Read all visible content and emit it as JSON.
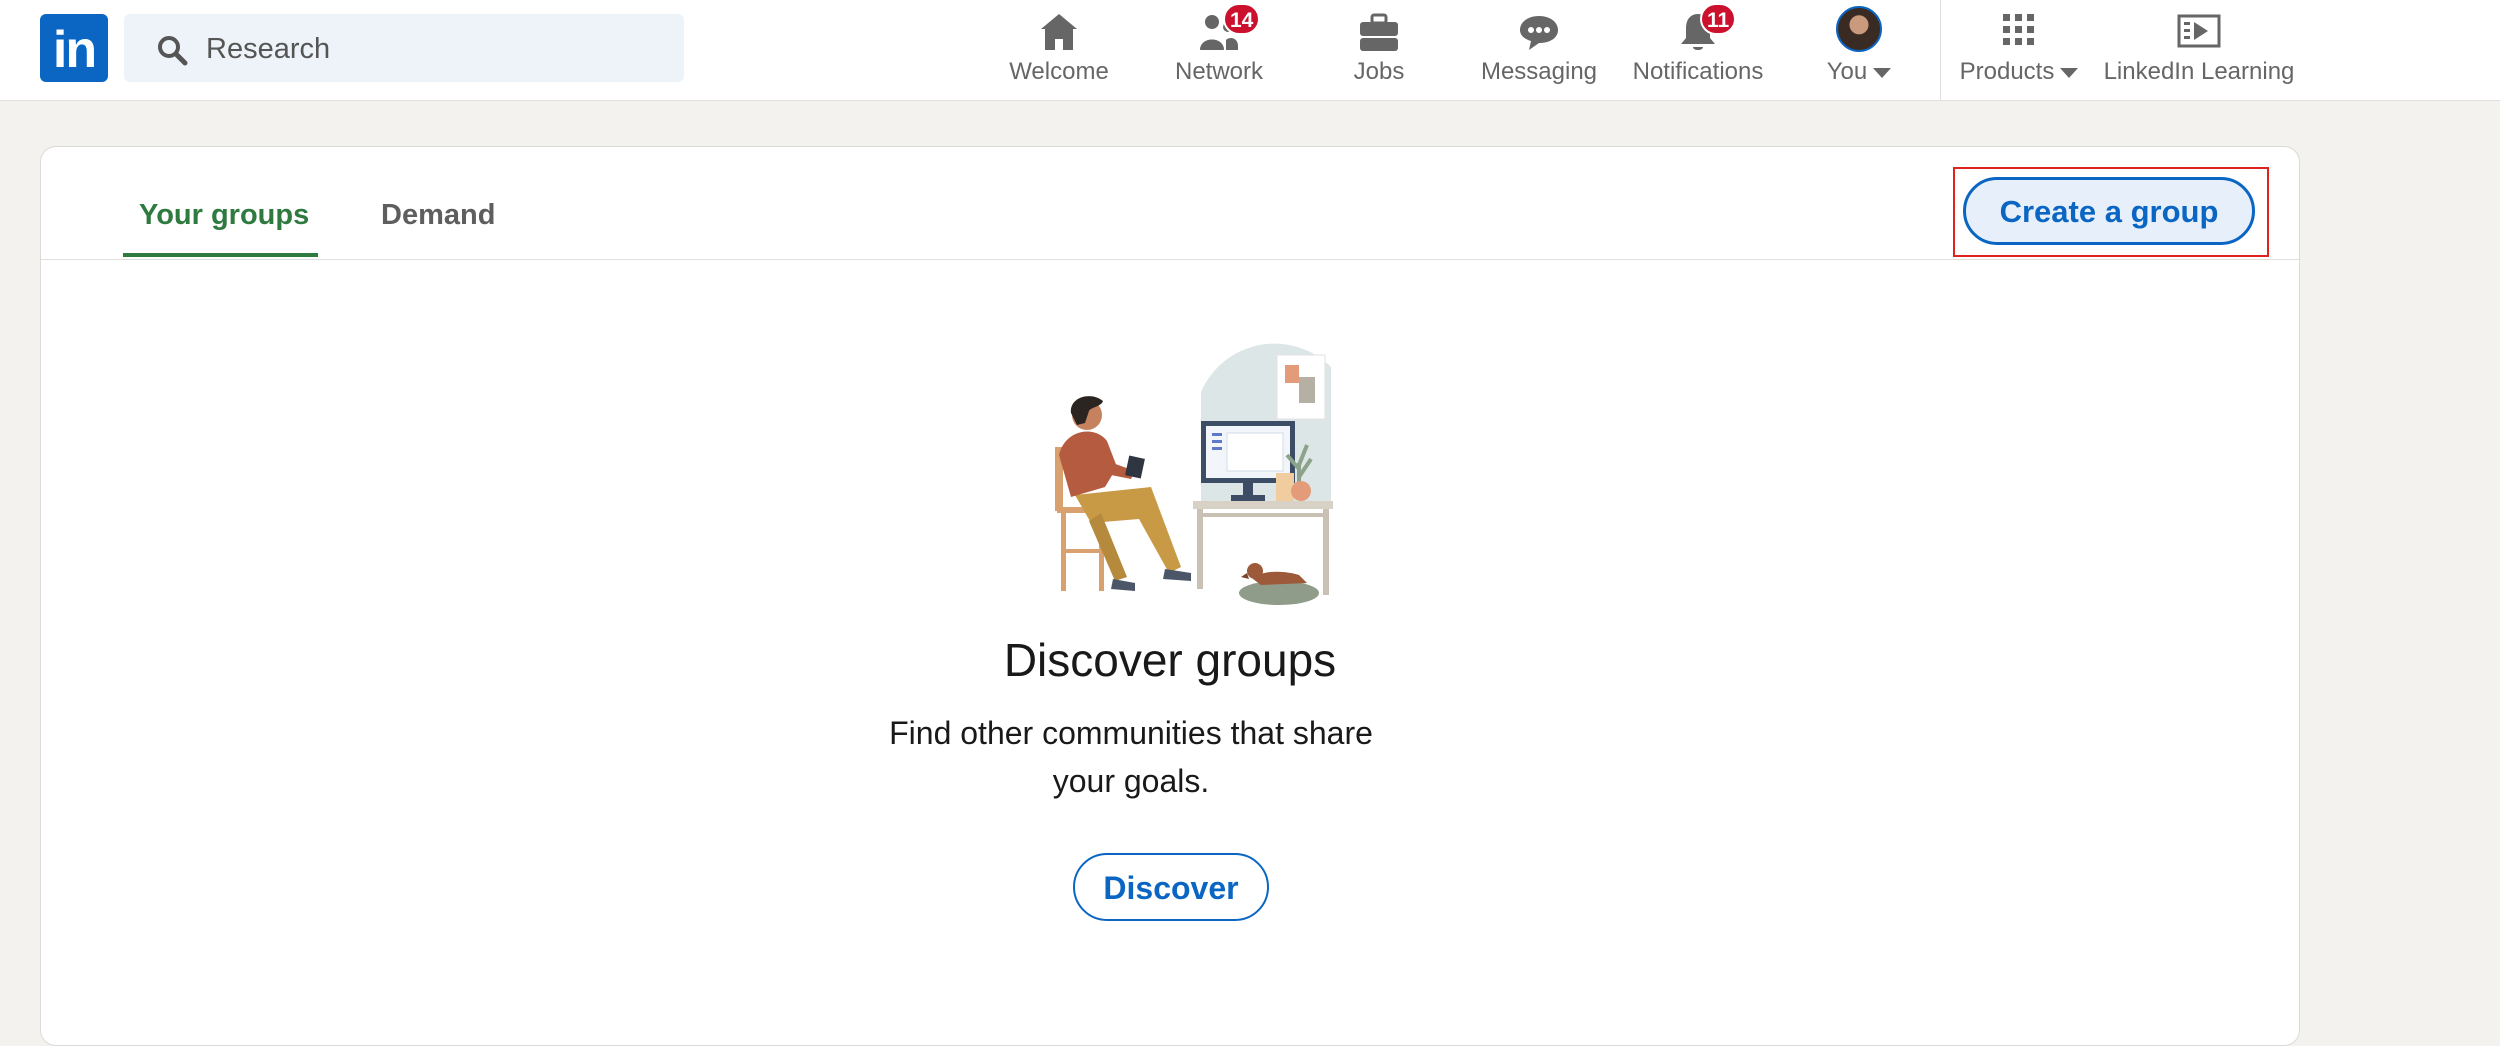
{
  "logo": {
    "text": "in"
  },
  "search": {
    "placeholder": "Research"
  },
  "nav": {
    "welcome": {
      "label": "Welcome"
    },
    "network": {
      "label": "Network",
      "badge": "14"
    },
    "jobs": {
      "label": "Jobs"
    },
    "messaging": {
      "label": "Messaging"
    },
    "notifications": {
      "label": "Notifications",
      "badge": "11"
    },
    "you": {
      "label": "You"
    },
    "products": {
      "label": "Products"
    },
    "learning": {
      "label": "LinkedIn Learning"
    }
  },
  "tabs": [
    {
      "label": "Your groups",
      "active": true
    },
    {
      "label": "Demand",
      "active": false
    }
  ],
  "actions": {
    "create_group": "Create a group"
  },
  "empty_state": {
    "title": "Discover groups",
    "description": "Find other communities that share your goals.",
    "button": "Discover"
  },
  "colors": {
    "brand": "#0a66c2",
    "active_tab": "#2f7a3f",
    "badge": "#cb112d",
    "page_bg": "#f4f2ee",
    "highlight_outline": "#e0231e"
  },
  "icons": [
    "search-icon",
    "home-icon",
    "network-icon",
    "briefcase-icon",
    "messaging-icon",
    "bell-icon",
    "avatar",
    "grid-icon",
    "learning-icon"
  ]
}
